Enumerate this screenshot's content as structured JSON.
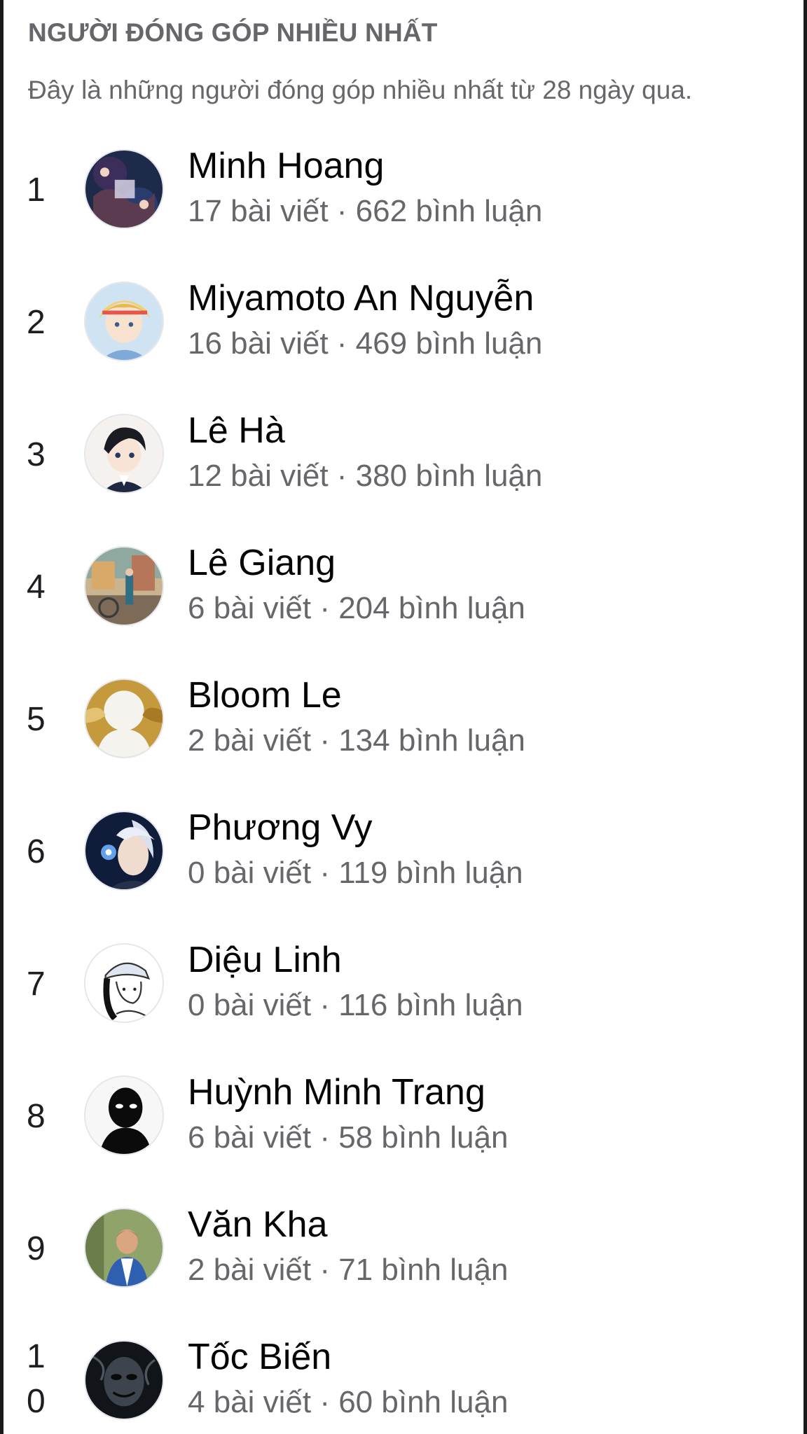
{
  "section": {
    "title": "NGƯỜI ĐÓNG GÓP NHIỀU NHẤT",
    "description": "Đây là những người đóng góp nhiều nhất từ 28 ngày qua."
  },
  "contributors": [
    {
      "rank": "1",
      "name": "Minh Hoang",
      "stats": "17 bài viết · 662 bình luận",
      "avatar_icon": "anime-collage-avatar"
    },
    {
      "rank": "2",
      "name": "Miyamoto An Nguyễn",
      "stats": "16 bài viết · 469 bình luận",
      "avatar_icon": "anime-blonde-avatar"
    },
    {
      "rank": "3",
      "name": "Lê Hà",
      "stats": "12 bài viết · 380 bình luận",
      "avatar_icon": "anime-boy-avatar"
    },
    {
      "rank": "4",
      "name": "Lê Giang",
      "stats": "6 bài viết · 204 bình luận",
      "avatar_icon": "street-photo-avatar"
    },
    {
      "rank": "5",
      "name": "Bloom Le",
      "stats": "2 bài viết · 134 bình luận",
      "avatar_icon": "gold-silhouette-avatar"
    },
    {
      "rank": "6",
      "name": "Phương Vy",
      "stats": "0 bài viết · 119 bình luận",
      "avatar_icon": "anime-dark-avatar"
    },
    {
      "rank": "7",
      "name": "Diệu Linh",
      "stats": "0 bài viết · 116 bình luận",
      "avatar_icon": "sketch-cap-avatar"
    },
    {
      "rank": "8",
      "name": "Huỳnh Minh Trang",
      "stats": "6 bài viết · 58 bình luận",
      "avatar_icon": "black-silhouette-avatar"
    },
    {
      "rank": "9",
      "name": "Văn Kha",
      "stats": "2 bài viết · 71 bình luận",
      "avatar_icon": "person-photo-avatar"
    },
    {
      "rank": "10",
      "name": "Tốc Biến",
      "stats": "4 bài viết · 60 bình luận",
      "avatar_icon": "masked-face-avatar"
    }
  ]
}
